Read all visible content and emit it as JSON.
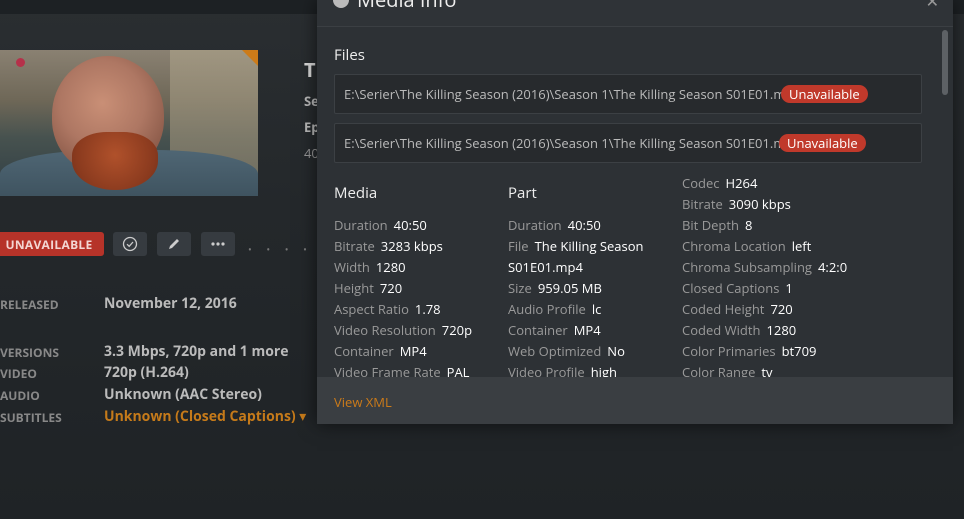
{
  "background": {
    "title_initial": "T",
    "meta_lines": [
      "Se",
      "Ep",
      "40"
    ],
    "unavailable_label": "UNAVAILABLE",
    "action_icons": [
      "check-icon",
      "edit-icon",
      "more-icon"
    ],
    "info": [
      {
        "label": "RELEASED",
        "value": "November 12, 2016"
      },
      {
        "label": "VERSIONS",
        "value": "3.3 Mbps, 720p  and 1 more"
      },
      {
        "label": "VIDEO",
        "value": "720p (H.264)"
      },
      {
        "label": "AUDIO",
        "value": "Unknown (AAC Stereo)"
      },
      {
        "label": "SUBTITLES",
        "value": "Unknown (Closed Captions) ▾"
      }
    ]
  },
  "modal": {
    "title": "Media Info",
    "files_heading": "Files",
    "files": [
      {
        "path": "E:\\Serier\\The Killing Season (2016)\\Season 1\\The Killing Season S01E01.mp4",
        "status": "Unavailable"
      },
      {
        "path": "E:\\Serier\\The Killing Season (2016)\\Season 1\\The Killing Season S01E01.mkv",
        "status": "Unavailable"
      }
    ],
    "media": {
      "heading": "Media",
      "rows": [
        {
          "k": "Duration",
          "v": "40:50"
        },
        {
          "k": "Bitrate",
          "v": "3283 kbps"
        },
        {
          "k": "Width",
          "v": "1280"
        },
        {
          "k": "Height",
          "v": "720"
        },
        {
          "k": "Aspect Ratio",
          "v": "1.78"
        },
        {
          "k": "Video Resolution",
          "v": "720p"
        },
        {
          "k": "Container",
          "v": "MP4"
        },
        {
          "k": "Video Frame Rate",
          "v": "PAL"
        }
      ]
    },
    "part": {
      "heading": "Part",
      "rows": [
        {
          "k": "Duration",
          "v": "40:50"
        },
        {
          "k": "File",
          "v": "The Killing Season"
        },
        {
          "k": "",
          "v": "S01E01.mp4"
        },
        {
          "k": "Size",
          "v": "959.05 MB"
        },
        {
          "k": "Audio Profile",
          "v": "lc"
        },
        {
          "k": "Container",
          "v": "MP4"
        },
        {
          "k": "Web Optimized",
          "v": "No"
        },
        {
          "k": "Video Profile",
          "v": "high"
        }
      ]
    },
    "stream": {
      "rows": [
        {
          "k": "Codec",
          "v": "H264"
        },
        {
          "k": "Bitrate",
          "v": "3090 kbps"
        },
        {
          "k": "Bit Depth",
          "v": "8"
        },
        {
          "k": "Chroma Location",
          "v": "left"
        },
        {
          "k": "Chroma Subsampling",
          "v": "4:2:0"
        },
        {
          "k": "Closed Captions",
          "v": "1"
        },
        {
          "k": "Coded Height",
          "v": "720"
        },
        {
          "k": "Coded Width",
          "v": "1280"
        },
        {
          "k": "Color Primaries",
          "v": "bt709"
        },
        {
          "k": "Color Range",
          "v": "tv"
        }
      ]
    },
    "view_xml": "View XML"
  },
  "colors": {
    "accent": "#cc7b19",
    "unavailable": "#c0392b",
    "panel": "#2d3135"
  }
}
